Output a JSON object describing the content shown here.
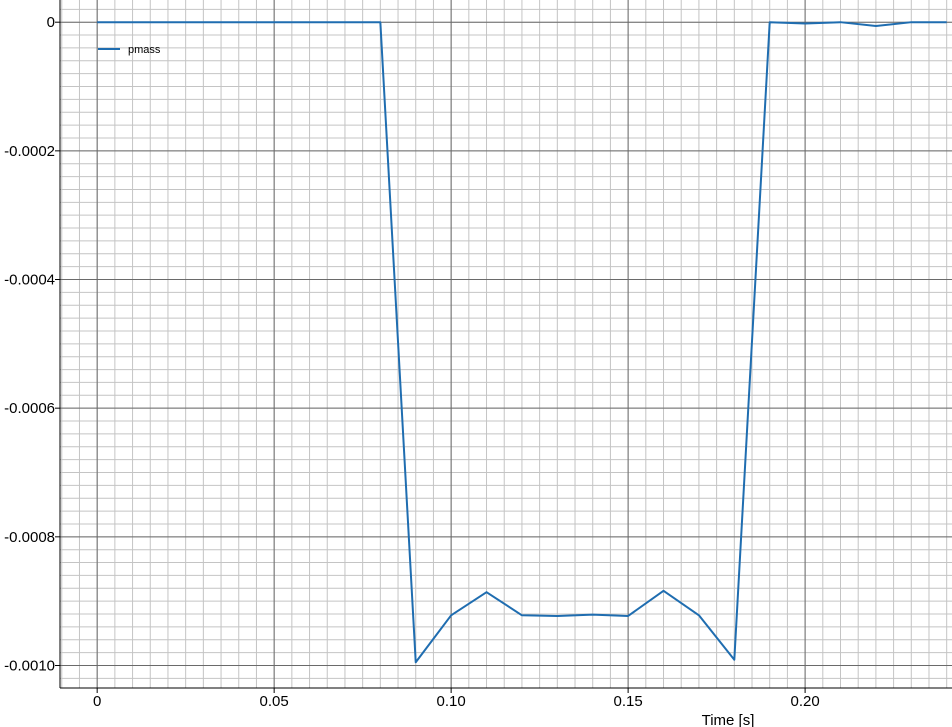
{
  "chart_data": {
    "type": "line",
    "title": "",
    "xlabel": "Time [s]",
    "ylabel": "",
    "xlim": [
      -0.0105,
      0.2415
    ],
    "ylim": [
      -0.001035,
      3.45e-05
    ],
    "grid": true,
    "legend_position": "top-left",
    "x_ticks": [
      {
        "value": 0,
        "label": "0"
      },
      {
        "value": 0.05,
        "label": "0.05"
      },
      {
        "value": 0.1,
        "label": "0.10"
      },
      {
        "value": 0.15,
        "label": "0.15"
      },
      {
        "value": 0.2,
        "label": "0.20"
      }
    ],
    "y_ticks": [
      {
        "value": 0,
        "label": "0"
      },
      {
        "value": -0.0002,
        "label": "-0.0002"
      },
      {
        "value": -0.0004,
        "label": "-0.0004"
      },
      {
        "value": -0.0006,
        "label": "-0.0006"
      },
      {
        "value": -0.0008,
        "label": "-0.0008"
      },
      {
        "value": -0.001,
        "label": "-0.0010"
      }
    ],
    "series": [
      {
        "name": "pmass",
        "color": "#1f6db0",
        "x": [
          0,
          0.01,
          0.02,
          0.03,
          0.04,
          0.05,
          0.06,
          0.07,
          0.08,
          0.09,
          0.1,
          0.11,
          0.12,
          0.13,
          0.14,
          0.15,
          0.16,
          0.17,
          0.18,
          0.19,
          0.2,
          0.21,
          0.22,
          0.23,
          0.24
        ],
        "y": [
          0,
          0,
          0,
          0,
          0,
          0,
          0,
          0,
          0,
          -0.000995,
          -0.000922,
          -0.000886,
          -0.000922,
          -0.000923,
          -0.000921,
          -0.000923,
          -0.000884,
          -0.000922,
          -0.000991,
          0,
          -2e-06,
          0,
          -6e-06,
          0,
          0
        ]
      }
    ]
  }
}
